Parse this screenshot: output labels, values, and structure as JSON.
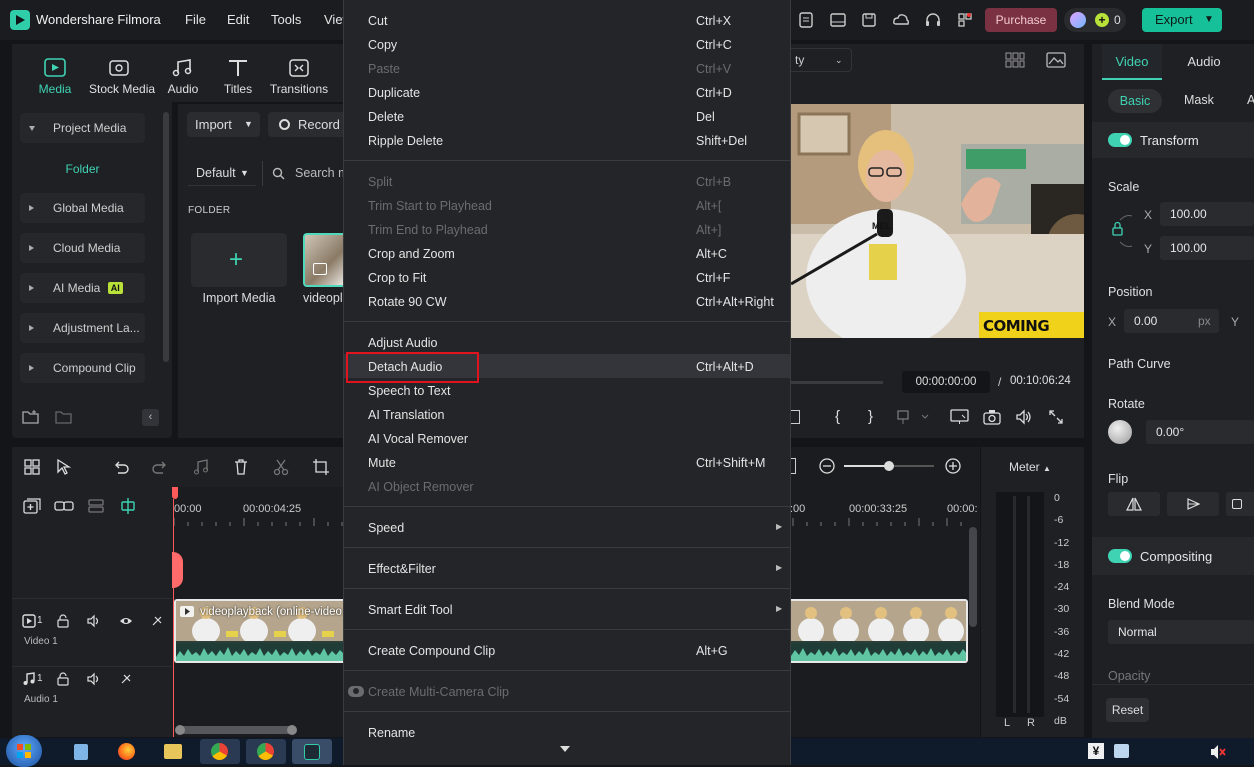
{
  "app": {
    "title": "Wondershare Filmora"
  },
  "menubar": [
    "File",
    "Edit",
    "Tools",
    "View"
  ],
  "topright": {
    "purchase": "Purchase",
    "credits": "0",
    "export": "Export"
  },
  "tooltabs": [
    "Media",
    "Stock Media",
    "Audio",
    "Titles",
    "Transitions"
  ],
  "leftnav": {
    "project_media": "Project Media",
    "folder": "Folder",
    "items": [
      "Global Media",
      "Cloud Media",
      "AI Media",
      "Adjustment La...",
      "Compound Clip"
    ],
    "ai_badge": "AI"
  },
  "assets": {
    "import": "Import",
    "record": "Record",
    "sort": "Default",
    "search_placeholder": "Search m",
    "folder_label": "FOLDER",
    "import_media": "Import Media",
    "video_name": "videopl"
  },
  "context_menu": {
    "groups": [
      [
        {
          "label": "Cut",
          "shortcut": "Ctrl+X",
          "disabled": false
        },
        {
          "label": "Copy",
          "shortcut": "Ctrl+C",
          "disabled": false
        },
        {
          "label": "Paste",
          "shortcut": "Ctrl+V",
          "disabled": true
        },
        {
          "label": "Duplicate",
          "shortcut": "Ctrl+D",
          "disabled": false
        },
        {
          "label": "Delete",
          "shortcut": "Del",
          "disabled": false
        },
        {
          "label": "Ripple Delete",
          "shortcut": "Shift+Del",
          "disabled": false
        }
      ],
      [
        {
          "label": "Split",
          "shortcut": "Ctrl+B",
          "disabled": true
        },
        {
          "label": "Trim Start to Playhead",
          "shortcut": "Alt+[",
          "disabled": true
        },
        {
          "label": "Trim End to Playhead",
          "shortcut": "Alt+]",
          "disabled": true
        },
        {
          "label": "Crop and Zoom",
          "shortcut": "Alt+C",
          "disabled": false
        },
        {
          "label": "Crop to Fit",
          "shortcut": "Ctrl+F",
          "disabled": false
        },
        {
          "label": "Rotate 90 CW",
          "shortcut": "Ctrl+Alt+Right",
          "disabled": false
        }
      ],
      [
        {
          "label": "Adjust Audio",
          "shortcut": "",
          "disabled": false
        },
        {
          "label": "Detach Audio",
          "shortcut": "Ctrl+Alt+D",
          "disabled": false,
          "highlighted": true
        },
        {
          "label": "Speech to Text",
          "shortcut": "",
          "disabled": false
        },
        {
          "label": "AI Translation",
          "shortcut": "",
          "disabled": false
        },
        {
          "label": "AI Vocal Remover",
          "shortcut": "",
          "disabled": false
        },
        {
          "label": "Mute",
          "shortcut": "Ctrl+Shift+M",
          "disabled": false
        },
        {
          "label": "AI Object Remover",
          "shortcut": "",
          "disabled": true
        }
      ],
      [
        {
          "label": "Speed",
          "shortcut": "",
          "submenu": true
        }
      ],
      [
        {
          "label": "Effect&Filter",
          "shortcut": "",
          "submenu": true
        }
      ],
      [
        {
          "label": "Smart Edit Tool",
          "shortcut": "",
          "submenu": true
        }
      ],
      [
        {
          "label": "Create Compound Clip",
          "shortcut": "Alt+G"
        }
      ],
      [
        {
          "label": "Create Multi-Camera Clip",
          "shortcut": "",
          "disabled": true
        }
      ],
      [
        {
          "label": "Rename",
          "shortcut": ""
        }
      ]
    ]
  },
  "player": {
    "quality": "ty",
    "current_time": "00:00:00:00",
    "separator": "/",
    "total_time": "00:10:06:24",
    "overlay_text": "COMING UP...",
    "sign_text": "MEL"
  },
  "inspector": {
    "tabs": [
      "Video",
      "Audio"
    ],
    "subtabs": [
      "Basic",
      "Mask",
      "A"
    ],
    "transform": "Transform",
    "scale": "Scale",
    "scale_x_label": "X",
    "scale_x": "100.00",
    "scale_y_label": "Y",
    "scale_y": "100.00",
    "position": "Position",
    "pos_x_label": "X",
    "pos_x": "0.00",
    "pos_unit": "px",
    "pos_y_label": "Y",
    "path_curve": "Path Curve",
    "rotate": "Rotate",
    "rotate_value": "0.00°",
    "flip": "Flip",
    "compositing": "Compositing",
    "blend_mode": "Blend Mode",
    "blend_value": "Normal",
    "opacity": "Opacity",
    "reset": "Reset"
  },
  "timeline": {
    "ruler": [
      "00:00",
      "00:00:04:25",
      ":00",
      "00:00:33:25",
      "00:00:"
    ],
    "video_track": "Video 1",
    "video_track_num": "1",
    "audio_track": "Audio 1",
    "audio_track_num": "1",
    "clip_name": "videoplayback (online-video"
  },
  "meter": {
    "title": "Meter",
    "scale": [
      "0",
      "-6",
      "-12",
      "-18",
      "-24",
      "-30",
      "-36",
      "-42",
      "-48",
      "-54",
      "dB"
    ],
    "left": "L",
    "right": "R"
  },
  "colors": {
    "accent": "#3fd3b3",
    "purchase": "#7a3243",
    "export": "#16c19a",
    "highlight_box": "#e0141e"
  }
}
